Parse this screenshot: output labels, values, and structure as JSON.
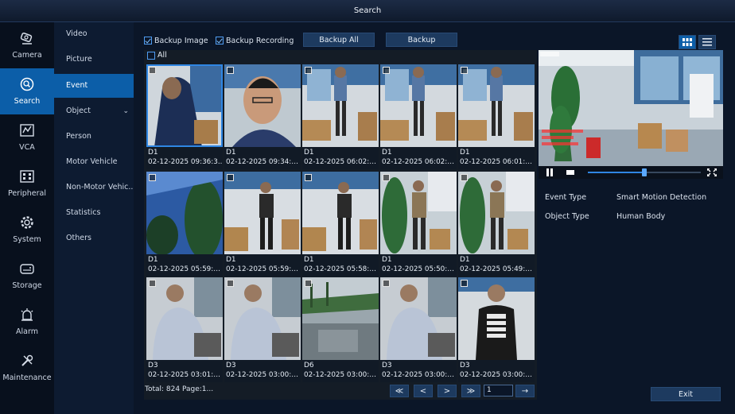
{
  "window": {
    "title": "Search"
  },
  "rail": [
    {
      "label": "Camera",
      "icon": "camera-icon",
      "active": false
    },
    {
      "label": "Search",
      "icon": "search-icon",
      "active": true
    },
    {
      "label": "VCA",
      "icon": "vca-icon",
      "active": false
    },
    {
      "label": "Peripheral",
      "icon": "peripheral-icon",
      "active": false
    },
    {
      "label": "System",
      "icon": "gear-icon",
      "active": false
    },
    {
      "label": "Storage",
      "icon": "storage-icon",
      "active": false
    },
    {
      "label": "Alarm",
      "icon": "alarm-icon",
      "active": false
    },
    {
      "label": "Maintenance",
      "icon": "tools-icon",
      "active": false
    }
  ],
  "submenu": [
    {
      "label": "Video",
      "active": false
    },
    {
      "label": "Picture",
      "active": false
    },
    {
      "label": "Event",
      "active": true
    },
    {
      "label": "Object",
      "active": false,
      "expandable": true
    },
    {
      "label": "Person",
      "active": false
    },
    {
      "label": "Motor Vehicle",
      "active": false
    },
    {
      "label": "Non-Motor Vehic..",
      "active": false
    },
    {
      "label": "Statistics",
      "active": false
    },
    {
      "label": "Others",
      "active": false
    }
  ],
  "toolbar": {
    "backup_image_label": "Backup Image",
    "backup_image_checked": true,
    "backup_recording_label": "Backup Recording",
    "backup_recording_checked": true,
    "backup_all_label": "Backup All",
    "backup_label": "Backup",
    "all_label": "All"
  },
  "results": [
    {
      "camera": "D1",
      "time": "02-12-2025 09:36:3..",
      "scene": "A",
      "selected": true
    },
    {
      "camera": "D1",
      "time": "02-12-2025 09:34:1...",
      "scene": "B",
      "selected": false
    },
    {
      "camera": "D1",
      "time": "02-12-2025 06:02:3...",
      "scene": "C",
      "selected": false
    },
    {
      "camera": "D1",
      "time": "02-12-2025 06:02:1...",
      "scene": "C",
      "selected": false
    },
    {
      "camera": "D1",
      "time": "02-12-2025 06:01:5...",
      "scene": "C",
      "selected": false
    },
    {
      "camera": "D1",
      "time": "02-12-2025 05:59:1...",
      "scene": "D",
      "selected": false
    },
    {
      "camera": "D1",
      "time": "02-12-2025 05:59:0...",
      "scene": "E",
      "selected": false
    },
    {
      "camera": "D1",
      "time": "02-12-2025 05:58:2...",
      "scene": "E",
      "selected": false
    },
    {
      "camera": "D1",
      "time": "02-12-2025 05:50:1...",
      "scene": "F",
      "selected": false
    },
    {
      "camera": "D1",
      "time": "02-12-2025 05:49:5...",
      "scene": "F",
      "selected": false
    },
    {
      "camera": "D3",
      "time": "02-12-2025 03:01:3...",
      "scene": "G",
      "selected": false
    },
    {
      "camera": "D3",
      "time": "02-12-2025 03:00:5...",
      "scene": "G",
      "selected": false
    },
    {
      "camera": "D6",
      "time": "02-12-2025 03:00:5...",
      "scene": "H",
      "selected": false
    },
    {
      "camera": "D3",
      "time": "02-12-2025 03:00:3...",
      "scene": "G",
      "selected": false
    },
    {
      "camera": "D3",
      "time": "02-12-2025 03:00:1...",
      "scene": "I",
      "selected": false
    }
  ],
  "pager": {
    "total_text": "Total: 824  Page:1...",
    "first": "≪",
    "prev": "<",
    "next": ">",
    "last": "≫",
    "page_value": "1",
    "go": "→"
  },
  "playback": {
    "progress": 0.5
  },
  "details": {
    "event_type_label": "Event Type",
    "event_type_value": "Smart Motion Detection",
    "object_type_label": "Object Type",
    "object_type_value": "Human Body"
  },
  "exit_label": "Exit",
  "colors": {
    "accent": "#0c5ea8",
    "selection": "#2f86e3",
    "background": "#0b1628"
  }
}
